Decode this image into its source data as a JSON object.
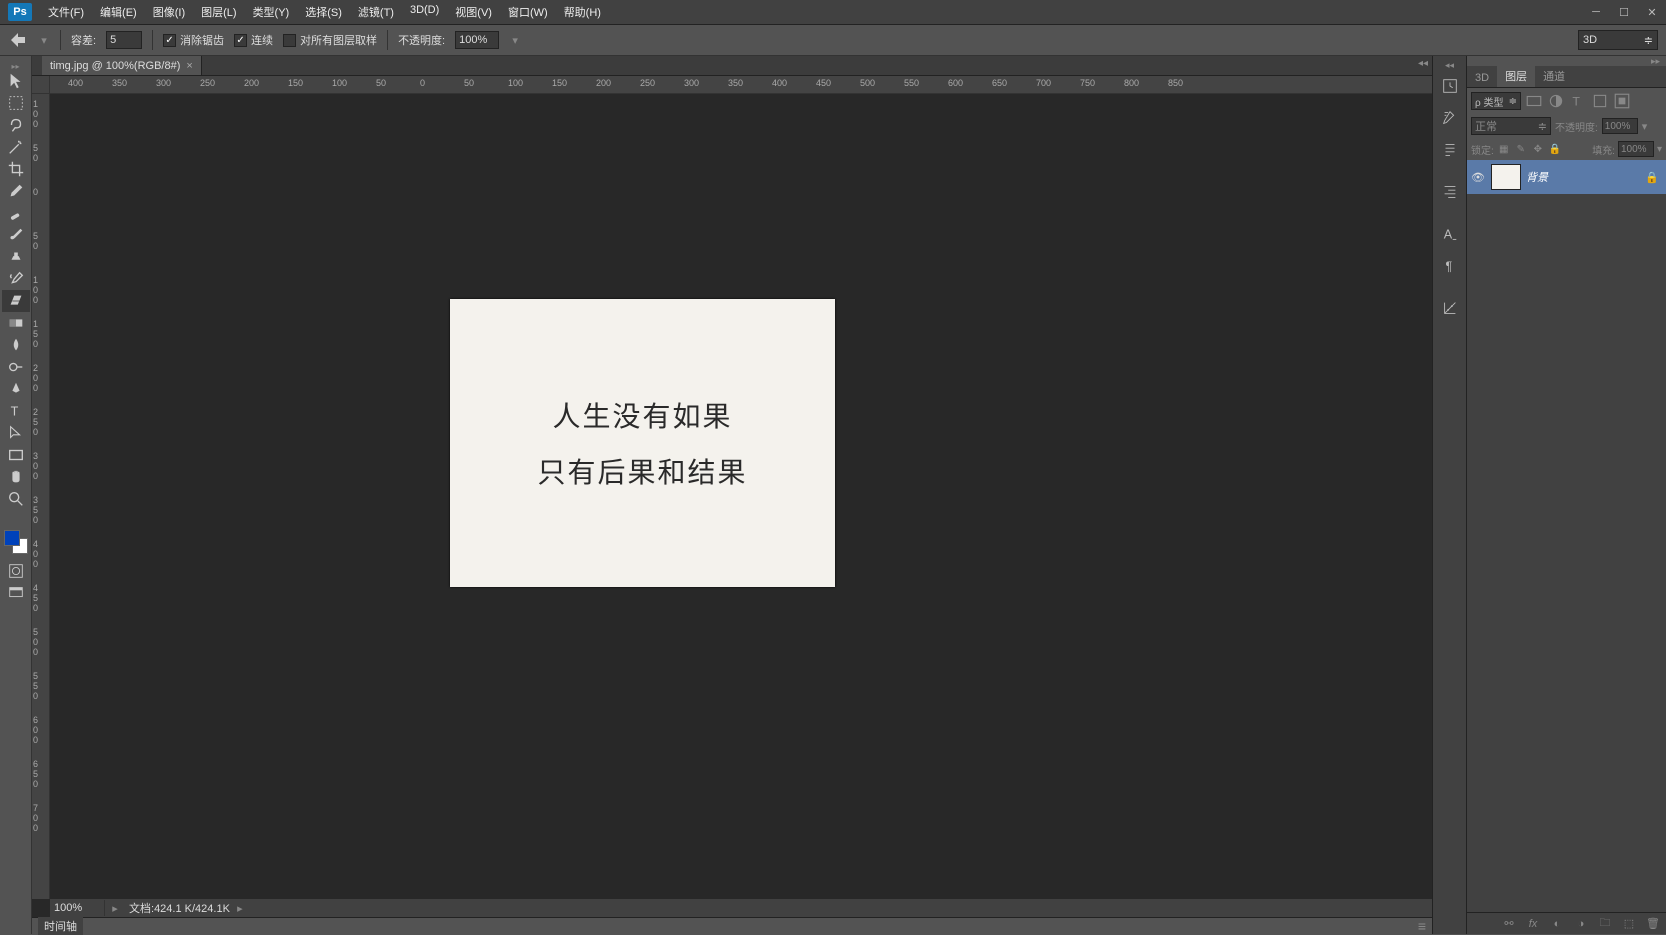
{
  "titlebar": {
    "logo": "Ps"
  },
  "menu": [
    {
      "label": "文件(F)"
    },
    {
      "label": "编辑(E)"
    },
    {
      "label": "图像(I)"
    },
    {
      "label": "图层(L)"
    },
    {
      "label": "类型(Y)"
    },
    {
      "label": "选择(S)"
    },
    {
      "label": "滤镜(T)"
    },
    {
      "label": "3D(D)"
    },
    {
      "label": "视图(V)"
    },
    {
      "label": "窗口(W)"
    },
    {
      "label": "帮助(H)"
    }
  ],
  "options": {
    "tolerance_label": "容差:",
    "tolerance_value": "5",
    "antialias_label": "消除锯齿",
    "contiguous_label": "连续",
    "sample_all_label": "对所有图层取样",
    "opacity_label": "不透明度:",
    "opacity_value": "100%",
    "mode_value": "3D"
  },
  "document": {
    "tab_title": "timg.jpg @ 100%(RGB/8#)",
    "zoom": "100%",
    "doc_label": "文档:",
    "doc_size": "424.1 K/424.1K",
    "canvas_line1": "人生没有如果",
    "canvas_line2": "只有后果和结果"
  },
  "ruler_h": [
    -400,
    -350,
    -300,
    -250,
    -200,
    -150,
    -100,
    -50,
    0,
    50,
    100,
    150,
    200,
    250,
    300,
    350,
    400,
    450,
    500,
    550,
    600,
    650,
    700,
    750,
    800,
    850
  ],
  "ruler_v": [
    -100,
    -50,
    0,
    50,
    100,
    150,
    200,
    250,
    300,
    350,
    400,
    450,
    500,
    550,
    600,
    650,
    700
  ],
  "timeline": {
    "tab": "时间轴"
  },
  "panels": {
    "tabs": [
      "3D",
      "图层",
      "通道"
    ],
    "active_tab": 1,
    "filter_label": "类型",
    "blend_mode": "正常",
    "opacity_label": "不透明度:",
    "opacity_value": "100%",
    "lock_label": "锁定:",
    "fill_label": "填充:",
    "fill_value": "100%",
    "layers": [
      {
        "name": "背景",
        "locked": true,
        "visible": true
      }
    ]
  },
  "colors": {
    "foreground": "#0042ba",
    "background": "#ffffff"
  }
}
